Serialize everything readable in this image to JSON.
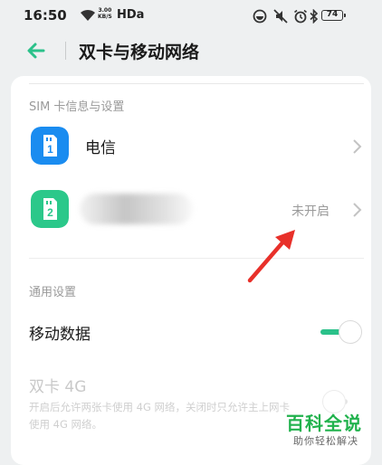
{
  "status_bar": {
    "time": "16:50",
    "speed_value": "3.00",
    "speed_unit": "KB/S",
    "hd_label": "HDa",
    "battery": "74"
  },
  "header": {
    "title": "双卡与移动网络"
  },
  "sim_section": {
    "label": "SIM 卡信息与设置",
    "sims": [
      {
        "slot": "1",
        "name": "电信",
        "status": "",
        "icon_color": "#1a8cf0"
      },
      {
        "slot": "2",
        "name": "",
        "status": "未开启",
        "icon_color": "#2bc88a"
      }
    ]
  },
  "general_section": {
    "label": "通用设置",
    "mobile_data": {
      "label": "移动数据",
      "enabled": true
    },
    "dual_4g": {
      "label": "双卡 4G",
      "description": "开启后允许两张卡使用 4G 网络，关闭时只允许主上网卡使用 4G 网络。",
      "enabled": false
    }
  },
  "watermark": {
    "main": "百科全说",
    "sub": "助你轻松解决"
  },
  "colors": {
    "accent": "#2bc18a",
    "sim1": "#1a8cf0",
    "sim2": "#2bc88a",
    "annotation_arrow": "#e8302a"
  }
}
